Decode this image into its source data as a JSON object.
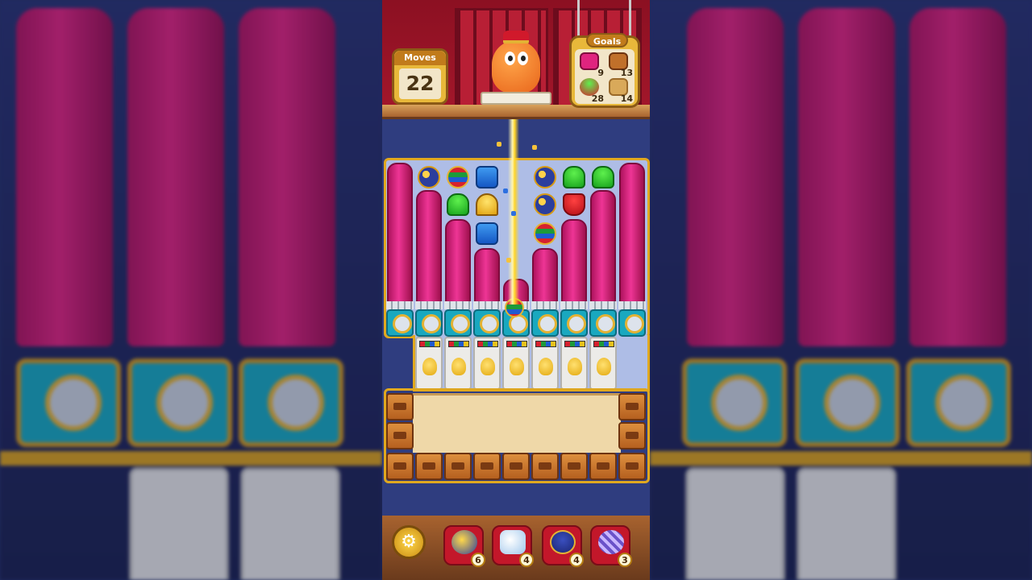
{
  "hud": {
    "moves_label": "Moves",
    "moves_value": "22",
    "goals_label": "Goals",
    "goals": [
      {
        "icon": "pink-curtain-icon",
        "count": "9",
        "color": "#e0247f"
      },
      {
        "icon": "wooden-box-icon",
        "count": "13",
        "color": "#c0702a"
      },
      {
        "icon": "potted-plant-icon",
        "count": "28",
        "color": "#3aa12b"
      },
      {
        "icon": "sand-tile-icon",
        "count": "14",
        "color": "#d9a95a"
      }
    ]
  },
  "toolbar": {
    "settings_icon": "gear-icon",
    "boosters": [
      {
        "icon": "hammer-booster-icon",
        "count": "6"
      },
      {
        "icon": "glove-booster-icon",
        "count": "4"
      },
      {
        "icon": "bell-booster-icon",
        "count": "4"
      },
      {
        "icon": "disco-ball-booster-icon",
        "count": "3"
      }
    ]
  },
  "colors": {
    "curtain": "#e0247f",
    "board_border": "#e0a81f",
    "clock_body": "#19a8bf",
    "panel_gold": "#e8b83a",
    "wall_red": "#a4172b"
  }
}
